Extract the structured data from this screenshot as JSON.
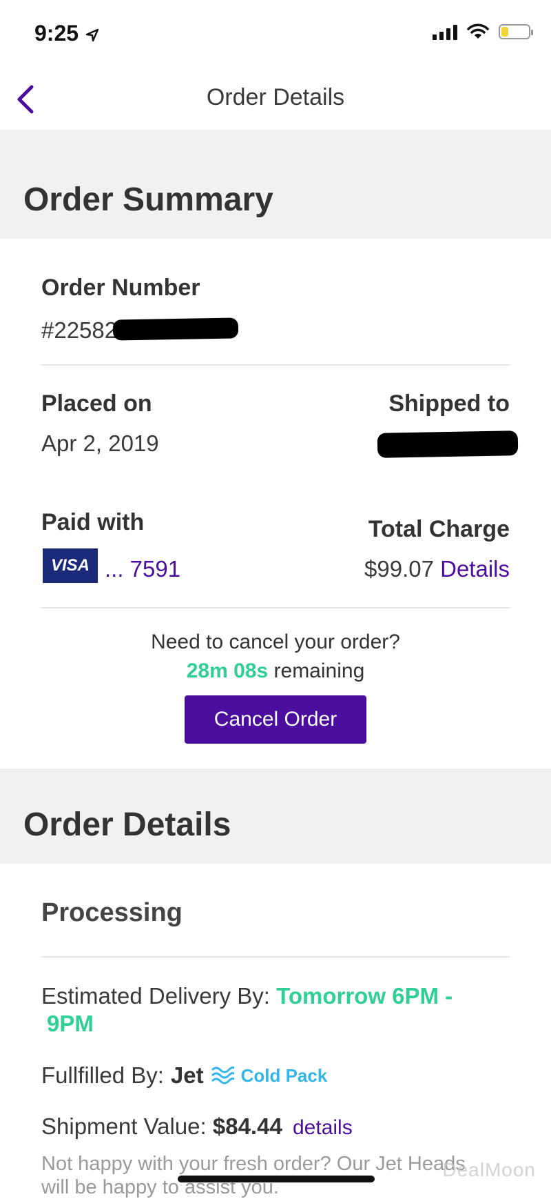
{
  "status_bar": {
    "time": "9:25"
  },
  "nav": {
    "title": "Order Details"
  },
  "summary": {
    "heading": "Order Summary",
    "order_number_label": "Order Number",
    "order_number_value": "#22582",
    "placed_on_label": "Placed on",
    "placed_on_value": "Apr 2, 2019",
    "shipped_to_label": "Shipped to",
    "paid_with_label": "Paid with",
    "card_brand": "VISA",
    "card_last4": "... 7591",
    "total_charge_label": "Total Charge",
    "total_charge_value": "$99.07",
    "details_link": "Details"
  },
  "cancel": {
    "question": "Need to cancel your order?",
    "countdown": "28m 08s",
    "remaining": "remaining",
    "button": "Cancel Order"
  },
  "details": {
    "heading": "Order Details",
    "status": "Processing",
    "estimated_label": "Estimated Delivery By:",
    "estimated_value_line1": "Tomorrow 6PM -",
    "estimated_value_line2": "9PM",
    "fulfilled_label": "Fullfilled By:",
    "fulfilled_value": "Jet",
    "cold_pack": "Cold Pack",
    "shipment_label": "Shipment Value:",
    "shipment_value": "$84.44",
    "shipment_details_link": "details",
    "note_line1": "Not happy with your fresh order? Our Jet Heads",
    "note_line2": "will be happy to assist you."
  },
  "watermark": "DealMoon",
  "colors": {
    "accent": "#4a0d9e",
    "green": "#2fcf96",
    "blue": "#34b5e8"
  }
}
